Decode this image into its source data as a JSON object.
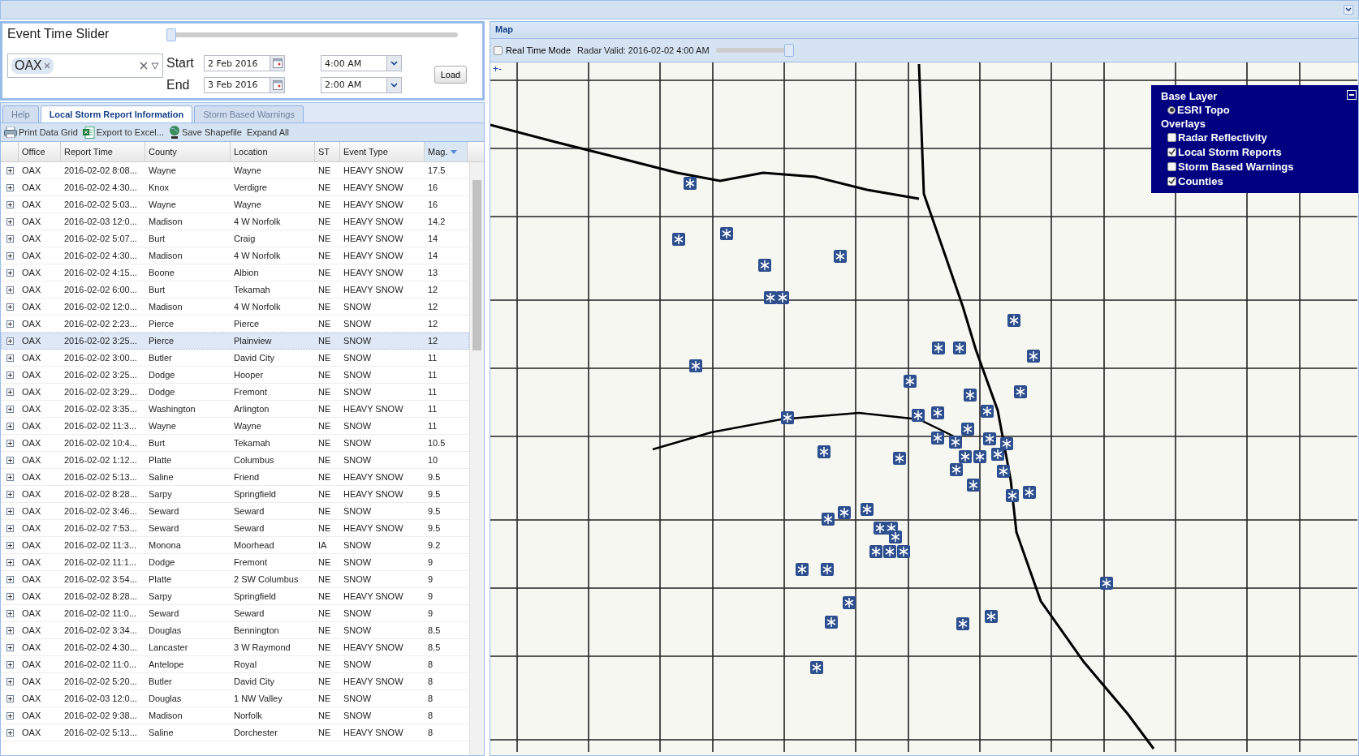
{
  "event_filter": {
    "title": "Event Time Slider",
    "slider": {
      "level": 0
    },
    "offices": [
      {
        "label": "OAX"
      }
    ],
    "range": [
      {
        "label": "Start",
        "date": "2 Feb 2016",
        "time": "4:00 AM"
      },
      {
        "label": "End",
        "date": "3 Feb 2016",
        "time": "2:00 AM"
      }
    ],
    "load_button": "Load"
  },
  "tabs": [
    {
      "label": "Help",
      "selected": false
    },
    {
      "label": "Local Storm Report Information",
      "selected": true
    },
    {
      "label": "Storm Based Warnings",
      "selected": false
    }
  ],
  "toolbar": [
    {
      "kind": "print",
      "label": "Print Data Grid"
    },
    {
      "kind": "excel",
      "label": "Export to Excel..."
    },
    {
      "kind": "globe",
      "label": "Save Shapefile"
    },
    {
      "kind": "plain",
      "label": "Expand All"
    }
  ],
  "table": {
    "columns": [
      {
        "label": "Office",
        "sorted": false
      },
      {
        "label": "Report Time",
        "sorted": false
      },
      {
        "label": "County",
        "sorted": false
      },
      {
        "label": "Location",
        "sorted": false
      },
      {
        "label": "ST",
        "sorted": false
      },
      {
        "label": "Event Type",
        "sorted": false
      },
      {
        "label": "Mag.",
        "sorted": true
      }
    ],
    "rows": [
      {
        "cells": [
          "OAX",
          "2016-02-02 8:08...",
          "Wayne",
          "Wayne",
          "NE",
          "HEAVY SNOW",
          "17.5"
        ],
        "selected": false
      },
      {
        "cells": [
          "OAX",
          "2016-02-02 4:30...",
          "Knox",
          "Verdigre",
          "NE",
          "HEAVY SNOW",
          "16"
        ],
        "selected": false
      },
      {
        "cells": [
          "OAX",
          "2016-02-02 5:03...",
          "Wayne",
          "Wayne",
          "NE",
          "HEAVY SNOW",
          "16"
        ],
        "selected": false
      },
      {
        "cells": [
          "OAX",
          "2016-02-03 12:0...",
          "Madison",
          "4 W Norfolk",
          "NE",
          "HEAVY SNOW",
          "14.2"
        ],
        "selected": false
      },
      {
        "cells": [
          "OAX",
          "2016-02-02 5:07...",
          "Burt",
          "Craig",
          "NE",
          "HEAVY SNOW",
          "14"
        ],
        "selected": false
      },
      {
        "cells": [
          "OAX",
          "2016-02-02 4:30...",
          "Madison",
          "4 W Norfolk",
          "NE",
          "HEAVY SNOW",
          "14"
        ],
        "selected": false
      },
      {
        "cells": [
          "OAX",
          "2016-02-02 4:15...",
          "Boone",
          "Albion",
          "NE",
          "HEAVY SNOW",
          "13"
        ],
        "selected": false
      },
      {
        "cells": [
          "OAX",
          "2016-02-02 6:00...",
          "Burt",
          "Tekamah",
          "NE",
          "HEAVY SNOW",
          "12"
        ],
        "selected": false
      },
      {
        "cells": [
          "OAX",
          "2016-02-02 12:0...",
          "Madison",
          "4 W Norfolk",
          "NE",
          "SNOW",
          "12"
        ],
        "selected": false
      },
      {
        "cells": [
          "OAX",
          "2016-02-02 2:23...",
          "Pierce",
          "Pierce",
          "NE",
          "SNOW",
          "12"
        ],
        "selected": false
      },
      {
        "cells": [
          "OAX",
          "2016-02-02 3:25...",
          "Pierce",
          "Plainview",
          "NE",
          "SNOW",
          "12"
        ],
        "selected": true
      },
      {
        "cells": [
          "OAX",
          "2016-02-02 3:00...",
          "Butler",
          "David City",
          "NE",
          "SNOW",
          "11"
        ],
        "selected": false
      },
      {
        "cells": [
          "OAX",
          "2016-02-02 3:25...",
          "Dodge",
          "Hooper",
          "NE",
          "SNOW",
          "11"
        ],
        "selected": false
      },
      {
        "cells": [
          "OAX",
          "2016-02-02 3:29...",
          "Dodge",
          "Fremont",
          "NE",
          "SNOW",
          "11"
        ],
        "selected": false
      },
      {
        "cells": [
          "OAX",
          "2016-02-02 3:35...",
          "Washington",
          "Arlington",
          "NE",
          "HEAVY SNOW",
          "11"
        ],
        "selected": false
      },
      {
        "cells": [
          "OAX",
          "2016-02-02 11:3...",
          "Wayne",
          "Wayne",
          "NE",
          "SNOW",
          "11"
        ],
        "selected": false
      },
      {
        "cells": [
          "OAX",
          "2016-02-02 10:4...",
          "Burt",
          "Tekamah",
          "NE",
          "SNOW",
          "10.5"
        ],
        "selected": false
      },
      {
        "cells": [
          "OAX",
          "2016-02-02 1:12...",
          "Platte",
          "Columbus",
          "NE",
          "SNOW",
          "10"
        ],
        "selected": false
      },
      {
        "cells": [
          "OAX",
          "2016-02-02 5:13...",
          "Saline",
          "Friend",
          "NE",
          "HEAVY SNOW",
          "9.5"
        ],
        "selected": false
      },
      {
        "cells": [
          "OAX",
          "2016-02-02 8:28...",
          "Sarpy",
          "Springfield",
          "NE",
          "HEAVY SNOW",
          "9.5"
        ],
        "selected": false
      },
      {
        "cells": [
          "OAX",
          "2016-02-02 3:46...",
          "Seward",
          "Seward",
          "NE",
          "SNOW",
          "9.5"
        ],
        "selected": false
      },
      {
        "cells": [
          "OAX",
          "2016-02-02 7:53...",
          "Seward",
          "Seward",
          "NE",
          "HEAVY SNOW",
          "9.5"
        ],
        "selected": false
      },
      {
        "cells": [
          "OAX",
          "2016-02-02 11:3...",
          "Monona",
          "Moorhead",
          "IA",
          "SNOW",
          "9.2"
        ],
        "selected": false
      },
      {
        "cells": [
          "OAX",
          "2016-02-02 11:1...",
          "Dodge",
          "Fremont",
          "NE",
          "SNOW",
          "9"
        ],
        "selected": false
      },
      {
        "cells": [
          "OAX",
          "2016-02-02 3:54...",
          "Platte",
          "2 SW Columbus",
          "NE",
          "SNOW",
          "9"
        ],
        "selected": false
      },
      {
        "cells": [
          "OAX",
          "2016-02-02 8:28...",
          "Sarpy",
          "Springfield",
          "NE",
          "HEAVY SNOW",
          "9"
        ],
        "selected": false
      },
      {
        "cells": [
          "OAX",
          "2016-02-02 11:0...",
          "Seward",
          "Seward",
          "NE",
          "SNOW",
          "9"
        ],
        "selected": false
      },
      {
        "cells": [
          "OAX",
          "2016-02-02 3:34...",
          "Douglas",
          "Bennington",
          "NE",
          "SNOW",
          "8.5"
        ],
        "selected": false
      },
      {
        "cells": [
          "OAX",
          "2016-02-02 4:30...",
          "Lancaster",
          "3 W Raymond",
          "NE",
          "HEAVY SNOW",
          "8.5"
        ],
        "selected": false
      },
      {
        "cells": [
          "OAX",
          "2016-02-02 11:0...",
          "Antelope",
          "Royal",
          "NE",
          "SNOW",
          "8"
        ],
        "selected": false
      },
      {
        "cells": [
          "OAX",
          "2016-02-02 5:20...",
          "Butler",
          "David City",
          "NE",
          "HEAVY SNOW",
          "8"
        ],
        "selected": false
      },
      {
        "cells": [
          "OAX",
          "2016-02-03 12:0...",
          "Douglas",
          "1 NW Valley",
          "NE",
          "SNOW",
          "8"
        ],
        "selected": false
      },
      {
        "cells": [
          "OAX",
          "2016-02-02 9:38...",
          "Madison",
          "Norfolk",
          "NE",
          "SNOW",
          "8"
        ],
        "selected": false
      },
      {
        "cells": [
          "OAX",
          "2016-02-02 5:13...",
          "Saline",
          "Dorchester",
          "NE",
          "HEAVY SNOW",
          "8"
        ],
        "selected": false
      }
    ]
  },
  "map": {
    "title": "Map",
    "real_time_mode": {
      "label": "Real Time Mode",
      "checked": false
    },
    "radar_valid": "Radar Valid: 2016-02-02 4:00 AM",
    "radar_slider": {
      "level": 1
    },
    "zoom_control": "+-",
    "legend": {
      "base_layer_title": "Base Layer",
      "base_layers": [
        {
          "label": "ESRI Topo",
          "selected": true
        }
      ],
      "overlays_title": "Overlays",
      "overlays": [
        {
          "label": "Radar Reflectivity",
          "checked": false
        },
        {
          "label": "Local Storm Reports",
          "checked": true
        },
        {
          "label": "Storm Based Warnings",
          "checked": false
        },
        {
          "label": "Counties",
          "checked": true
        }
      ]
    }
  }
}
